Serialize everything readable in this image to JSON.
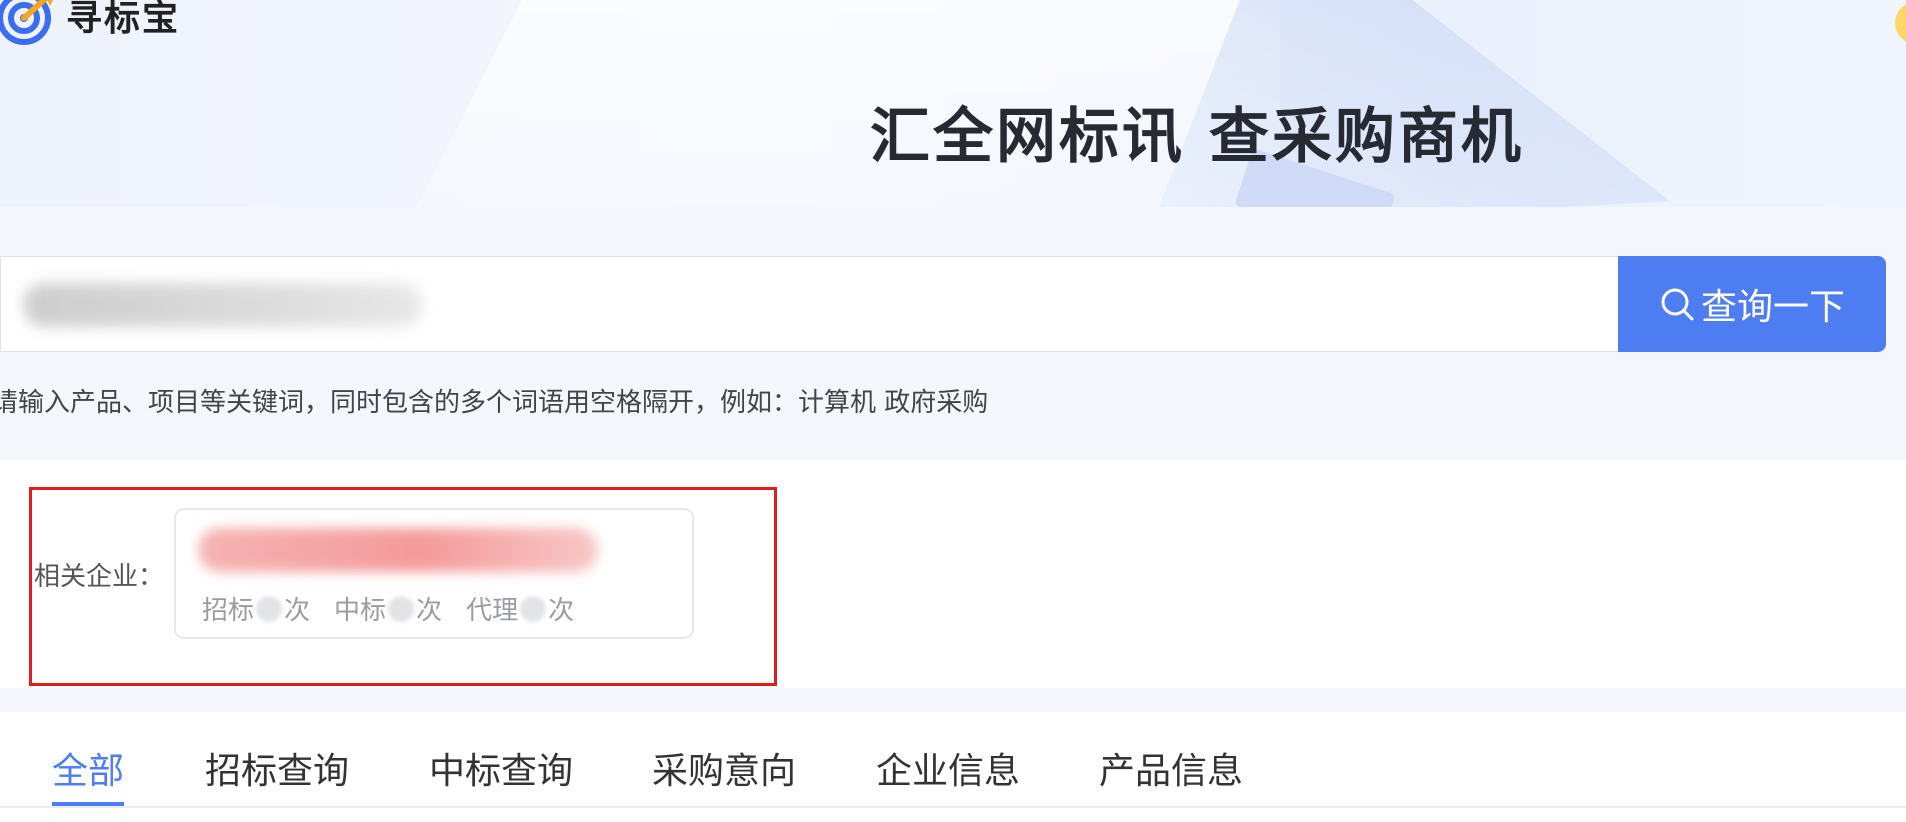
{
  "brand": {
    "name": "寻标宝",
    "logo_icon": "target-arrow-icon"
  },
  "hero": {
    "slogan": "汇全网标讯  查采购商机"
  },
  "search": {
    "value": "",
    "button_label": "查询一下",
    "button_icon": "search-icon"
  },
  "hint": "请输入产品、项目等关键词，同时包含的多个词语用空格隔开，例如：计算机 政府采购",
  "related": {
    "label": "相关企业：",
    "company": {
      "name": "",
      "stats": [
        {
          "prefix": "招标",
          "suffix": "次"
        },
        {
          "prefix": "中标",
          "suffix": "次"
        },
        {
          "prefix": "代理",
          "suffix": "次"
        }
      ]
    }
  },
  "tabs": {
    "items": [
      {
        "label": "全部",
        "active": true
      },
      {
        "label": "招标查询",
        "active": false
      },
      {
        "label": "中标查询",
        "active": false
      },
      {
        "label": "采购意向",
        "active": false
      },
      {
        "label": "企业信息",
        "active": false
      },
      {
        "label": "产品信息",
        "active": false
      }
    ]
  },
  "colors": {
    "accent": "#4e7df2",
    "highlight_border": "#e01e1e",
    "logo_blue": "#3a6df0",
    "logo_orange": "#f5a623"
  }
}
